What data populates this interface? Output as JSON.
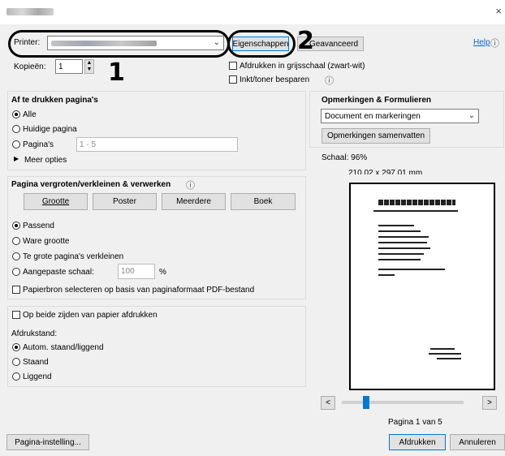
{
  "window": {
    "close_glyph": "×"
  },
  "printer": {
    "label": "Printer:",
    "properties_button": "Eigenschappen",
    "advanced_button": "Geavanceerd",
    "help_link": "Help",
    "copies_label": "Kopieën:",
    "copies_value": "1",
    "grayscale_label": "Afdrukken in grijsschaal (zwart-wit)",
    "save_ink_label": "Inkt/toner besparen"
  },
  "annotations": {
    "one": "1",
    "two": "2"
  },
  "pages_section": {
    "title": "Af te drukken pagina's",
    "all": "Alle",
    "current": "Huidige pagina",
    "pages": "Pagina's",
    "pages_value": "1 - 5",
    "more_options": "Meer opties"
  },
  "sizing_section": {
    "title": "Pagina vergroten/verkleinen & verwerken",
    "tabs": [
      "Grootte",
      "Poster",
      "Meerdere",
      "Boek"
    ],
    "fit": "Passend",
    "actual": "Ware grootte",
    "shrink": "Te grote pagina's verkleinen",
    "custom": "Aangepaste schaal:",
    "custom_value": "100",
    "percent": "%",
    "paper_source": "Papierbron selecteren op basis van paginaformaat PDF-bestand"
  },
  "duplex_section": {
    "both_sides": "Op beide zijden van papier afdrukken",
    "orientation_label": "Afdrukstand:",
    "auto": "Autom. staand/liggend",
    "portrait": "Staand",
    "landscape": "Liggend"
  },
  "comments_section": {
    "title": "Opmerkingen & Formulieren",
    "select_value": "Document en markeringen",
    "summarize_button": "Opmerkingen samenvatten"
  },
  "preview": {
    "scale": "Schaal: 96%",
    "dimensions": "210,02 x 297,01 mm",
    "prev": "<",
    "next": ">",
    "page_indicator": "Pagina 1 van 5",
    "current_page_fraction": 0.2
  },
  "footer": {
    "page_setup": "Pagina-instelling...",
    "print": "Afdrukken",
    "cancel": "Annuleren"
  }
}
